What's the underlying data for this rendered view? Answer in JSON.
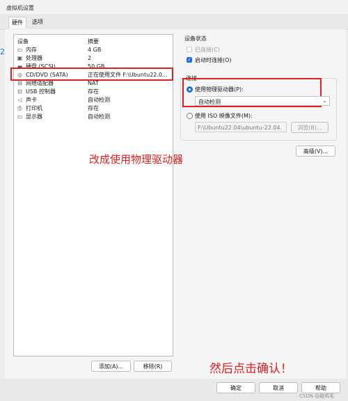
{
  "window": {
    "title": "虚拟机设置"
  },
  "tabs": [
    {
      "label": "硬件"
    },
    {
      "label": "选项"
    }
  ],
  "device_table": {
    "headers": {
      "device": "设备",
      "summary": "摘要"
    },
    "rows": [
      {
        "name": "内存",
        "summary": "4 GB",
        "icon": "memory-icon"
      },
      {
        "name": "处理器",
        "summary": "2",
        "icon": "processor-icon"
      },
      {
        "name": "硬盘 (SCSI)",
        "summary": "50 GB",
        "icon": "hard-disk-icon"
      },
      {
        "name": "CD/DVD (SATA)",
        "summary": "正在使用文件 F:\\Ubuntu22.0...",
        "icon": "cd-dvd-icon"
      },
      {
        "name": "网络适配器",
        "summary": "NAT",
        "icon": "network-adapter-icon"
      },
      {
        "name": "USB 控制器",
        "summary": "存在",
        "icon": "usb-icon"
      },
      {
        "name": "声卡",
        "summary": "自动检测",
        "icon": "sound-card-icon"
      },
      {
        "name": "打印机",
        "summary": "存在",
        "icon": "printer-icon"
      },
      {
        "name": "显示器",
        "summary": "自动检测",
        "icon": "display-icon"
      }
    ]
  },
  "left_buttons": {
    "add": "添加(A)...",
    "remove": "移除(R)"
  },
  "device_status": {
    "label": "设备状态",
    "connected": {
      "label": "已连接(C)",
      "checked": false,
      "enabled": false
    },
    "connect_at_power_on": {
      "label": "启动时连接(O)",
      "checked": true
    }
  },
  "connection": {
    "label": "连接",
    "physical": {
      "label": "使用物理驱动器(P):",
      "selected": true,
      "value": "自动检测"
    },
    "iso": {
      "label": "使用 ISO 映像文件(M):",
      "selected": false,
      "path": "F:\\Ubuntu22.04\\ubuntu-22.04.",
      "browse": "浏览(B)..."
    }
  },
  "advanced_button": "高级(V)...",
  "annotations": {
    "note1": "改成使用物理驱动器",
    "note2": "然后点击确认！"
  },
  "dialog_buttons": {
    "ok": "确定",
    "cancel": "取消",
    "help": "帮助"
  },
  "watermark": "CSDN @敲鸡毛",
  "colors": {
    "accent": "#1e6fd9",
    "annotation": "#e02020"
  }
}
